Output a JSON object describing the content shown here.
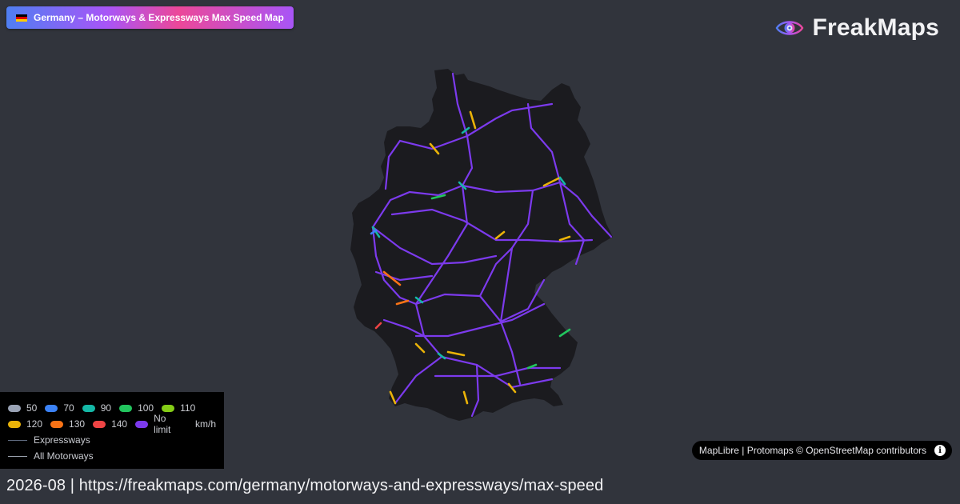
{
  "header": {
    "title": "Germany – Motorways & Expressways Max Speed Map",
    "flag_colors": [
      "#000000",
      "#dd0000",
      "#ffce00"
    ]
  },
  "brand": {
    "name": "FreakMaps",
    "logo_icon": "eye-logo-icon"
  },
  "map": {
    "background_color": "#31343c",
    "land_color": "#1b1b1f",
    "road_color_main": "#7c3aed"
  },
  "legend": {
    "speeds": [
      {
        "label": "50",
        "color": "#9aa3b5"
      },
      {
        "label": "70",
        "color": "#3b82f6"
      },
      {
        "label": "90",
        "color": "#14b8a6"
      },
      {
        "label": "100",
        "color": "#22c55e"
      },
      {
        "label": "110",
        "color": "#84cc16"
      },
      {
        "label": "120",
        "color": "#eab308"
      },
      {
        "label": "130",
        "color": "#f97316"
      },
      {
        "label": "140",
        "color": "#ef4444"
      },
      {
        "label": "No limit",
        "color": "#7c3aed"
      }
    ],
    "unit": "km/h",
    "lines": [
      {
        "label": "Expressways",
        "color": "#5f6b80"
      },
      {
        "label": "All Motorways",
        "color": "#9ca3af"
      }
    ]
  },
  "attribution": {
    "text": "MapLibre | Protomaps © OpenStreetMap contributors",
    "info_icon": "info-icon"
  },
  "footer": {
    "text": "2026-08 | https://freakmaps.com/germany/motorways-and-expressways/max-speed"
  }
}
